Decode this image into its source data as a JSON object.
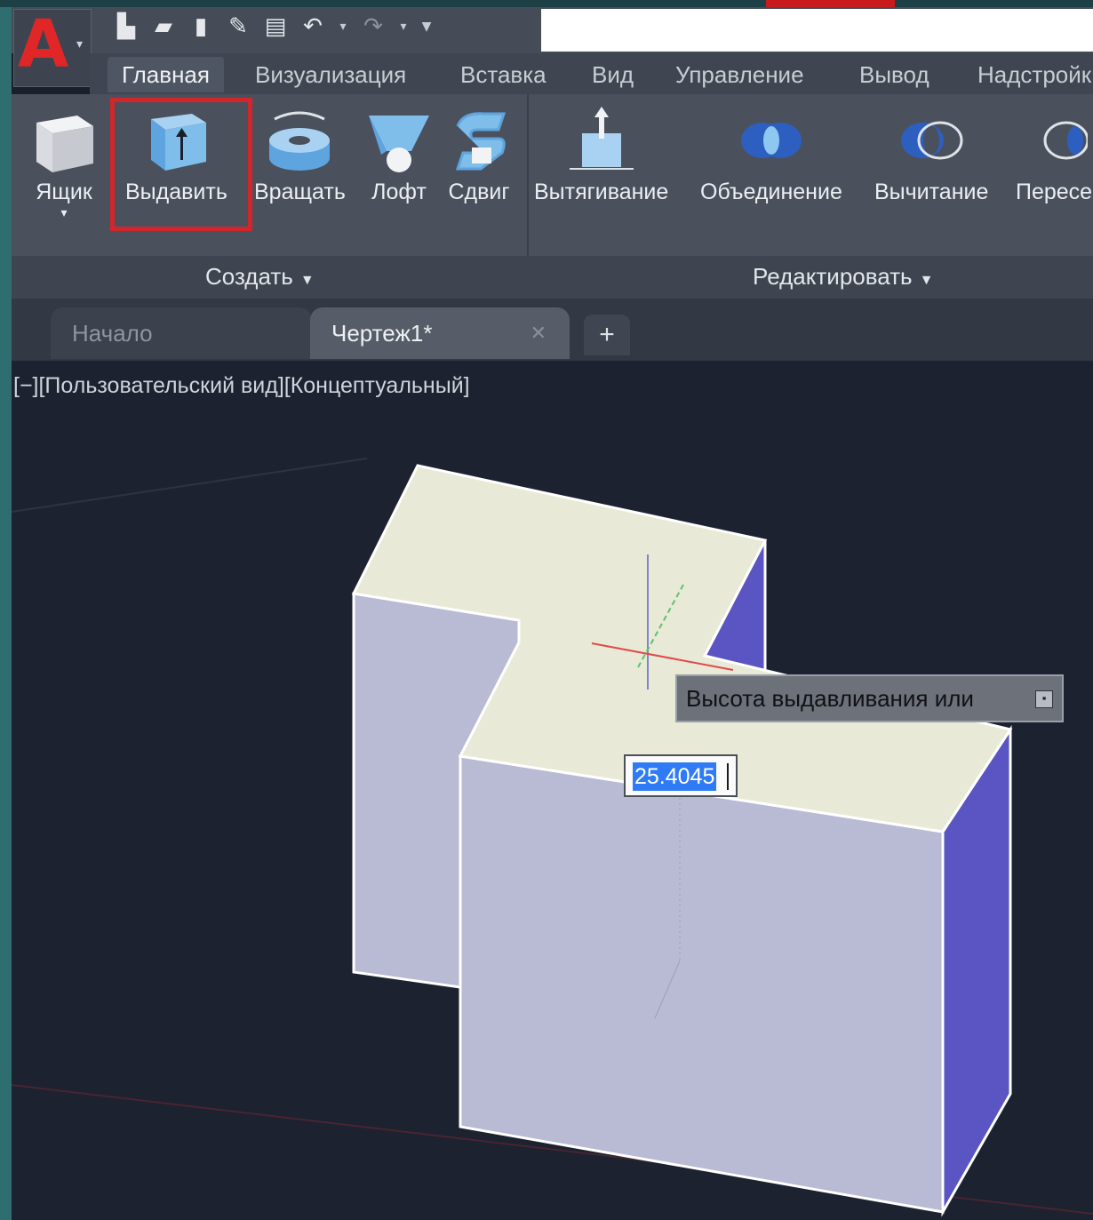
{
  "window": {
    "app_letter": "A"
  },
  "quick_access": {
    "icons": [
      "new-file-icon",
      "open-folder-icon",
      "save-icon",
      "save-as-icon",
      "print-icon",
      "undo-icon",
      "redo-icon",
      "customize-icon"
    ]
  },
  "ribbon_tabs": [
    "Главная",
    "Визуализация",
    "Вставка",
    "Вид",
    "Управление",
    "Вывод",
    "Надстройк"
  ],
  "ribbon_tab_active": "Главная",
  "create_group": {
    "title": "Создать",
    "tools": [
      "Ящик",
      "Выдавить",
      "Вращать",
      "Лофт",
      "Сдвиг"
    ],
    "highlighted_tool": "Выдавить"
  },
  "edit_group": {
    "title": "Редактировать",
    "tools": [
      "Вытягивание",
      "Объединение",
      "Вычитание",
      "Пересе"
    ]
  },
  "document_tabs": [
    "Начало",
    "Чертеж1*"
  ],
  "document_tab_active": "Чертеж1*",
  "viewport": {
    "label": "[−][Пользовательский вид][Концептуальный]"
  },
  "prompt": {
    "tooltip": "Высота выдавливания или",
    "input_value": "25.4045"
  },
  "colors": {
    "accent_red": "#d2262b",
    "selection_blue": "#2f7bf5",
    "solid_top": "#e8e9d6",
    "solid_front": "#b9bad3",
    "solid_side": "#5a55c2"
  }
}
